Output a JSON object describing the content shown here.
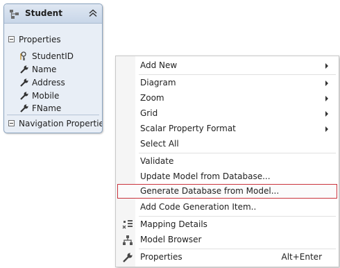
{
  "entity": {
    "title": "Student",
    "icon": "entity-type-icon",
    "collapse_icon": "double-chevron-up-icon",
    "sections": {
      "properties_label": "Properties",
      "navigation_label": "Navigation Properties"
    },
    "properties": [
      {
        "name": "StudentID",
        "icon": "key-icon"
      },
      {
        "name": "Name",
        "icon": "wrench-icon"
      },
      {
        "name": "Address",
        "icon": "wrench-icon"
      },
      {
        "name": "Mobile",
        "icon": "wrench-icon"
      },
      {
        "name": "FName",
        "icon": "wrench-icon"
      }
    ]
  },
  "menu": {
    "items": [
      {
        "label": "Add New",
        "submenu": true
      },
      {
        "label": "Diagram",
        "submenu": true
      },
      {
        "label": "Zoom",
        "submenu": true
      },
      {
        "label": "Grid",
        "submenu": true
      },
      {
        "label": "Scalar Property Format",
        "submenu": true
      },
      {
        "label": "Select All"
      },
      {
        "label": "Validate"
      },
      {
        "label": "Update Model from Database..."
      },
      {
        "label": "Generate Database from Model...",
        "highlighted": true
      },
      {
        "label": "Add Code Generation Item.."
      },
      {
        "label": "Mapping Details",
        "icon": "mapping-details-icon"
      },
      {
        "label": "Model Browser",
        "icon": "model-browser-icon"
      },
      {
        "label": "Properties",
        "icon": "wrench-icon",
        "shortcut": "Alt+Enter"
      }
    ]
  },
  "colors": {
    "highlight_border": "#c9323b",
    "entity_background": "#e8eef6"
  }
}
